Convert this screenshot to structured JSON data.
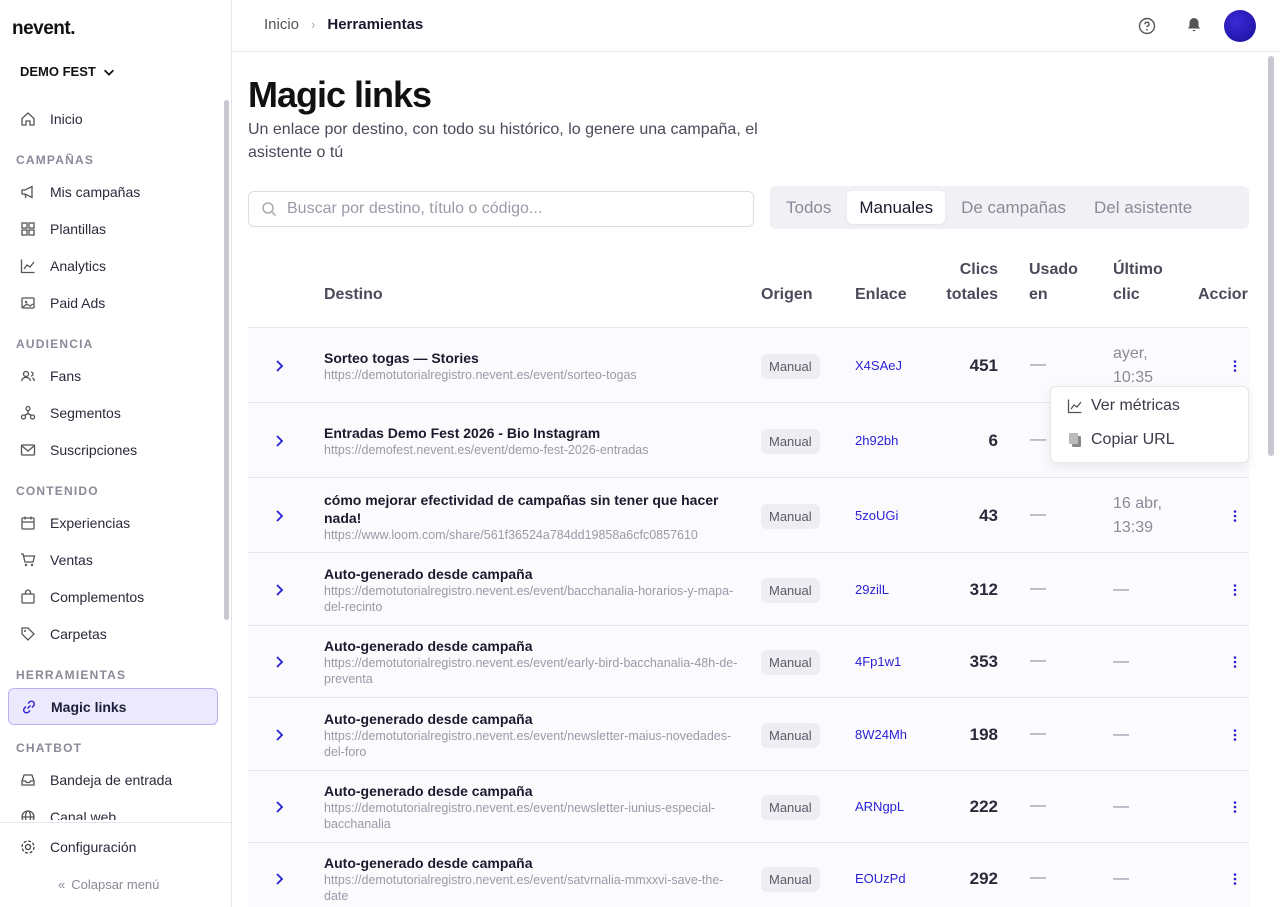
{
  "app": {
    "logo": "nevent.",
    "org": "DEMO FEST"
  },
  "sidebar": {
    "items": [
      {
        "type": "item",
        "label": "Inicio",
        "icon": "home-icon"
      },
      {
        "type": "section",
        "label": "CAMPAÑAS"
      },
      {
        "type": "item",
        "label": "Mis campañas",
        "icon": "megaphone-icon"
      },
      {
        "type": "item",
        "label": "Plantillas",
        "icon": "grid-icon"
      },
      {
        "type": "item",
        "label": "Analytics",
        "icon": "chart-icon"
      },
      {
        "type": "item",
        "label": "Paid Ads",
        "icon": "image-icon"
      },
      {
        "type": "section",
        "label": "AUDIENCIA"
      },
      {
        "type": "item",
        "label": "Fans",
        "icon": "users-icon"
      },
      {
        "type": "item",
        "label": "Segmentos",
        "icon": "segments-icon"
      },
      {
        "type": "item",
        "label": "Suscripciones",
        "icon": "mail-icon"
      },
      {
        "type": "section",
        "label": "CONTENIDO"
      },
      {
        "type": "item",
        "label": "Experiencias",
        "icon": "calendar-icon"
      },
      {
        "type": "item",
        "label": "Ventas",
        "icon": "cart-icon"
      },
      {
        "type": "item",
        "label": "Complementos",
        "icon": "bag-icon"
      },
      {
        "type": "item",
        "label": "Carpetas",
        "icon": "tag-icon"
      },
      {
        "type": "section",
        "label": "HERRAMIENTAS"
      },
      {
        "type": "item",
        "label": "Magic links",
        "icon": "link-icon",
        "active": true
      },
      {
        "type": "section",
        "label": "CHATBOT"
      },
      {
        "type": "item",
        "label": "Bandeja de entrada",
        "icon": "inbox-icon"
      },
      {
        "type": "item",
        "label": "Canal web",
        "icon": "globe-icon"
      }
    ],
    "config_label": "Configuración",
    "collapse_label": "Colapsar menú"
  },
  "breadcrumb": {
    "home": "Inicio",
    "current": "Herramientas"
  },
  "page": {
    "title": "Magic links",
    "subtitle": "Un enlace por destino, con todo su histórico, lo genere una campaña, el asistente o tú"
  },
  "search": {
    "placeholder": "Buscar por destino, título o código..."
  },
  "filters": [
    {
      "label": "Todos",
      "active": false
    },
    {
      "label": "Manuales",
      "active": true
    },
    {
      "label": "De campañas",
      "active": false
    },
    {
      "label": "Del asistente",
      "active": false
    }
  ],
  "table": {
    "headers": {
      "destino": "Destino",
      "origen": "Origen",
      "enlace": "Enlace",
      "clics_1": "Clics",
      "clics_2": "totales",
      "usado_1": "Usado",
      "usado_2": "en",
      "ultimo_1": "Último",
      "ultimo_2": "clic",
      "acciones": "Accior"
    },
    "rows": [
      {
        "title": "Sorteo togas — Stories",
        "url": "https://demotutorialregistro.nevent.es/event/sorteo-togas",
        "origin": "Manual",
        "code": "X4SAeJ",
        "clicks": "451",
        "used": "—",
        "last1": "ayer,",
        "last2": "10:35"
      },
      {
        "title": "Entradas Demo Fest 2026 - Bio Instagram",
        "url": "https://demofest.nevent.es/event/demo-fest-2026-entradas",
        "origin": "Manual",
        "code": "2h92bh",
        "clicks": "6",
        "used": "—",
        "last1": "",
        "last2": ""
      },
      {
        "title": "cómo mejorar efectividad de campañas sin tener que hacer nada!",
        "url": "https://www.loom.com/share/561f36524a784dd19858a6cfc0857610",
        "origin": "Manual",
        "code": "5zoUGi",
        "clicks": "43",
        "used": "—",
        "last1": "16 abr,",
        "last2": "13:39"
      },
      {
        "title": "Auto-generado desde campaña",
        "url": "https://demotutorialregistro.nevent.es/event/bacchanalia-horarios-y-mapa-del-recinto",
        "origin": "Manual",
        "code": "29zilL",
        "clicks": "312",
        "used": "—",
        "last1": "—",
        "last2": ""
      },
      {
        "title": "Auto-generado desde campaña",
        "url": "https://demotutorialregistro.nevent.es/event/early-bird-bacchanalia-48h-de-preventa",
        "origin": "Manual",
        "code": "4Fp1w1",
        "clicks": "353",
        "used": "—",
        "last1": "—",
        "last2": ""
      },
      {
        "title": "Auto-generado desde campaña",
        "url": "https://demotutorialregistro.nevent.es/event/newsletter-maius-novedades-del-foro",
        "origin": "Manual",
        "code": "8W24Mh",
        "clicks": "198",
        "used": "—",
        "last1": "—",
        "last2": ""
      },
      {
        "title": "Auto-generado desde campaña",
        "url": "https://demotutorialregistro.nevent.es/event/newsletter-iunius-especial-bacchanalia",
        "origin": "Manual",
        "code": "ARNgpL",
        "clicks": "222",
        "used": "—",
        "last1": "—",
        "last2": ""
      },
      {
        "title": "Auto-generado desde campaña",
        "url": "https://demotutorialregistro.nevent.es/event/satvrnalia-mmxxvi-save-the-date",
        "origin": "Manual",
        "code": "EOUzPd",
        "clicks": "292",
        "used": "—",
        "last1": "—",
        "last2": ""
      }
    ]
  },
  "row_menu": {
    "metrics": "Ver métricas",
    "copy": "Copiar URL"
  },
  "colors": {
    "accent": "#2a1fd4",
    "active_bg": "#ebe9fb"
  }
}
